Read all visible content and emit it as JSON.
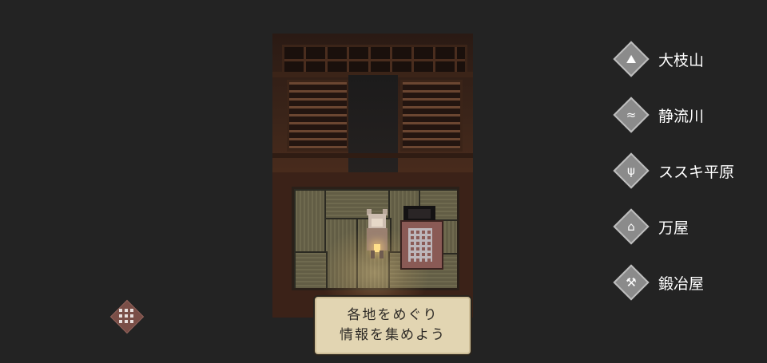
{
  "scene": {
    "description_icon": "room-scene"
  },
  "dialog": {
    "line1": "各地をめぐり",
    "line2": "情報を集めよう"
  },
  "locations": [
    {
      "label": "大枝山",
      "icon": "mountain-icon",
      "glyph": "⛰"
    },
    {
      "label": "静流川",
      "icon": "river-icon",
      "glyph": "≈"
    },
    {
      "label": "ススキ平原",
      "icon": "grass-icon",
      "glyph": "ψ"
    },
    {
      "label": "万屋",
      "icon": "shop-icon",
      "glyph": "⌂"
    },
    {
      "label": "鍛冶屋",
      "icon": "smithy-icon",
      "glyph": "⚒"
    }
  ],
  "colors": {
    "background": "#232323",
    "dialog_bg": "#e2d5b2",
    "location_diamond": "#8b8b8b",
    "menu_diamond": "#7a4e47"
  },
  "menu": {
    "icon": "grid-menu-icon"
  }
}
